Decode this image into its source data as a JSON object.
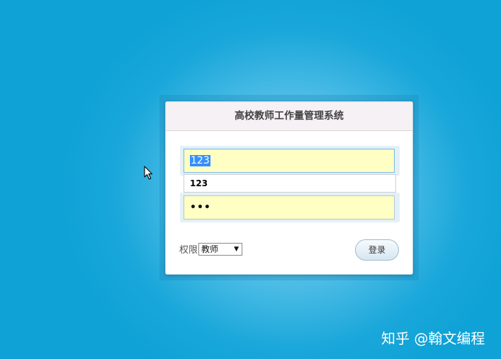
{
  "login": {
    "title": "高校教师工作量管理系统",
    "username_value": "123",
    "autocomplete_option": "123",
    "password_value": "•••",
    "role_label": "权限",
    "role_selected": "教师",
    "login_label": "登录"
  },
  "watermark": {
    "text": "知乎 @翰文编程"
  },
  "icons": {
    "cursor": "mouse-pointer-icon",
    "dropdown": "triangle-down-icon"
  },
  "colors": {
    "background": "#0ea2d6",
    "input_fill": "#ffffc4",
    "selection": "#3390ff"
  }
}
